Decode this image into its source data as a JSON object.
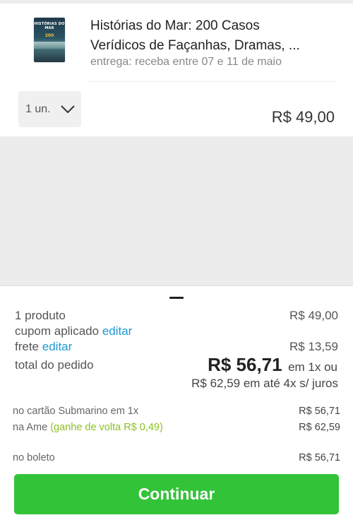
{
  "product": {
    "thumbnail_title": "HISTÓRIAS DO MAR",
    "thumbnail_number": "200",
    "title_line1": "Histórias do Mar: 200 Casos",
    "title_line2": "Verídicos de Façanhas, Dramas, ...",
    "delivery": "entrega: receba entre 07 e 11 de maio",
    "quantity": "1 un.",
    "price": "R$ 49,00"
  },
  "summary": {
    "products_label": "1 produto",
    "products_value": "R$ 49,00",
    "coupon_label": "cupom aplicado",
    "coupon_edit": "editar",
    "shipping_label": "frete",
    "shipping_edit": "editar",
    "shipping_value": "R$ 13,59",
    "total_label": "total do pedido",
    "total_value": "R$ 56,71",
    "total_suffix": "em 1x ou",
    "installments": "R$ 62,59 em até 4x s/ juros"
  },
  "payment_options": {
    "card_label": "no cartão Submarino em 1x",
    "card_value": "R$ 56,71",
    "ame_label": "na Ame",
    "ame_cashback": "(ganhe de volta R$ 0,49)",
    "ame_value": "R$ 62,59",
    "boleto_label": "no boleto",
    "boleto_value": "R$ 56,71"
  },
  "actions": {
    "continue_label": "Continuar"
  },
  "colors": {
    "accent_link": "#1f9ad6",
    "cashback_green": "#8cbf26",
    "continue_green": "#32c339"
  }
}
